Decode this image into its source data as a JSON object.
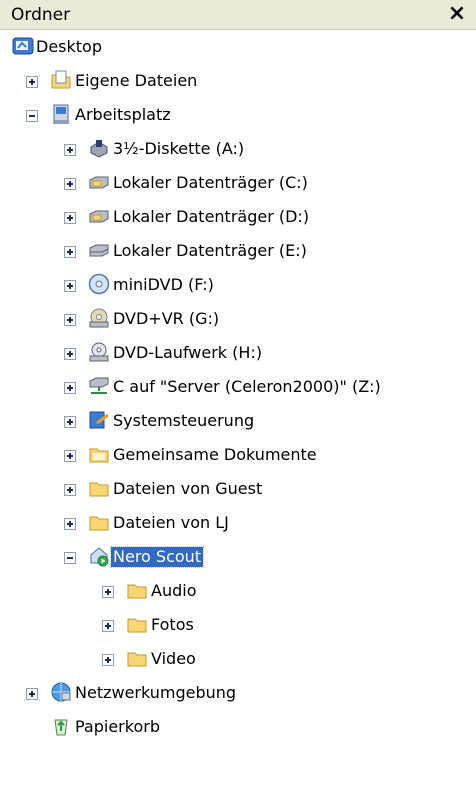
{
  "pane": {
    "title": "Ordner",
    "close_label": "×"
  },
  "tree": {
    "desktop": "Desktop",
    "eigene_dateien": "Eigene Dateien",
    "arbeitsplatz": "Arbeitsplatz",
    "diskette": "3½-Diskette (A:)",
    "drive_c": "Lokaler Datenträger (C:)",
    "drive_d": "Lokaler Datenträger (D:)",
    "drive_e": "Lokaler Datenträger (E:)",
    "minidvd": "miniDVD (F:)",
    "dvdvr": "DVD+VR (G:)",
    "dvd_laufwerk": "DVD-Laufwerk (H:)",
    "network_drive": "C auf \"Server (Celeron2000)\" (Z:)",
    "systemsteuerung": "Systemsteuerung",
    "gemeinsame_dokumente": "Gemeinsame Dokumente",
    "dateien_guest": "Dateien von Guest",
    "dateien_lj": "Dateien von LJ",
    "nero_scout": "Nero Scout",
    "audio": "Audio",
    "fotos": "Fotos",
    "video": "Video",
    "netzwerkumgebung": "Netzwerkumgebung",
    "papierkorb": "Papierkorb"
  },
  "selected_item": "Nero Scout",
  "colors": {
    "selection": "#316ac5",
    "header": "#ece9d8",
    "folder": "#f7d774"
  }
}
